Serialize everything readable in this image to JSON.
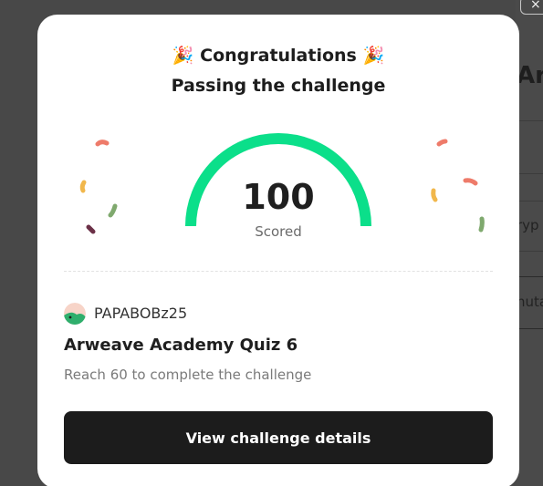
{
  "modal": {
    "headline": "Congratulations",
    "headline_emoji": "🎉",
    "subheadline": "Passing the challenge",
    "score": "100",
    "score_label": "Scored",
    "username": "PAPABOBz25",
    "quiz_title": "Arweave Academy Quiz 6",
    "requirement": "Reach 60 to complete the challenge",
    "cta_label": "View challenge details",
    "gauge_color": "#0bdf8a",
    "score_fraction": 1.0
  },
  "background": {
    "title_fragment": "Arv",
    "row_fragment_1": "ryp",
    "row_fragment_2": "nuta",
    "close_label": "×"
  }
}
